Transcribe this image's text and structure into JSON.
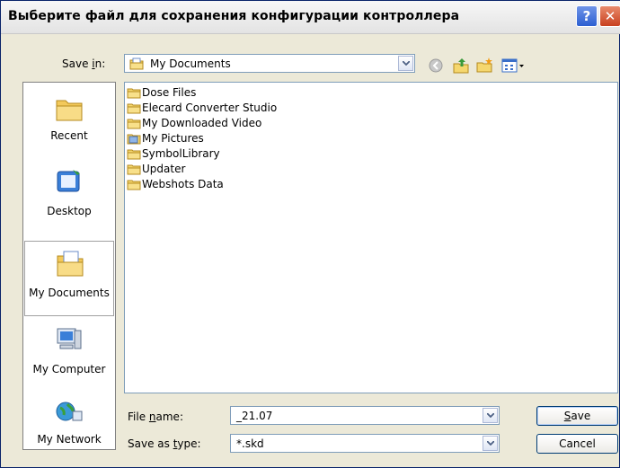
{
  "dialog": {
    "title": "Выберите файл для сохранения конфигурации контроллера",
    "help_label": "?",
    "close_label": "✕"
  },
  "save_in": {
    "label": "Save in:",
    "value": "My Documents"
  },
  "places": [
    {
      "label": "Recent"
    },
    {
      "label": "Desktop"
    },
    {
      "label": "My Documents"
    },
    {
      "label": "My Computer"
    },
    {
      "label": "My Network"
    }
  ],
  "files": [
    {
      "name": "Dose Files",
      "icon": "folder-icon"
    },
    {
      "name": "Elecard Converter Studio",
      "icon": "folder-icon"
    },
    {
      "name": "My Downloaded Video",
      "icon": "folder-icon"
    },
    {
      "name": "My Pictures",
      "icon": "pictures-folder-icon"
    },
    {
      "name": "SymbolLibrary",
      "icon": "folder-icon"
    },
    {
      "name": "Updater",
      "icon": "folder-icon"
    },
    {
      "name": "Webshots Data",
      "icon": "folder-icon"
    }
  ],
  "file_name": {
    "label": "File name:",
    "value": "_21.07"
  },
  "save_type": {
    "label": "Save as type:",
    "value": "*.skd"
  },
  "buttons": {
    "save": "Save",
    "cancel": "Cancel"
  },
  "colors": {
    "title_bg": "#f0f0f0",
    "dialog_bg": "#ece9d8",
    "folder_yellow": "#f5d76e"
  }
}
